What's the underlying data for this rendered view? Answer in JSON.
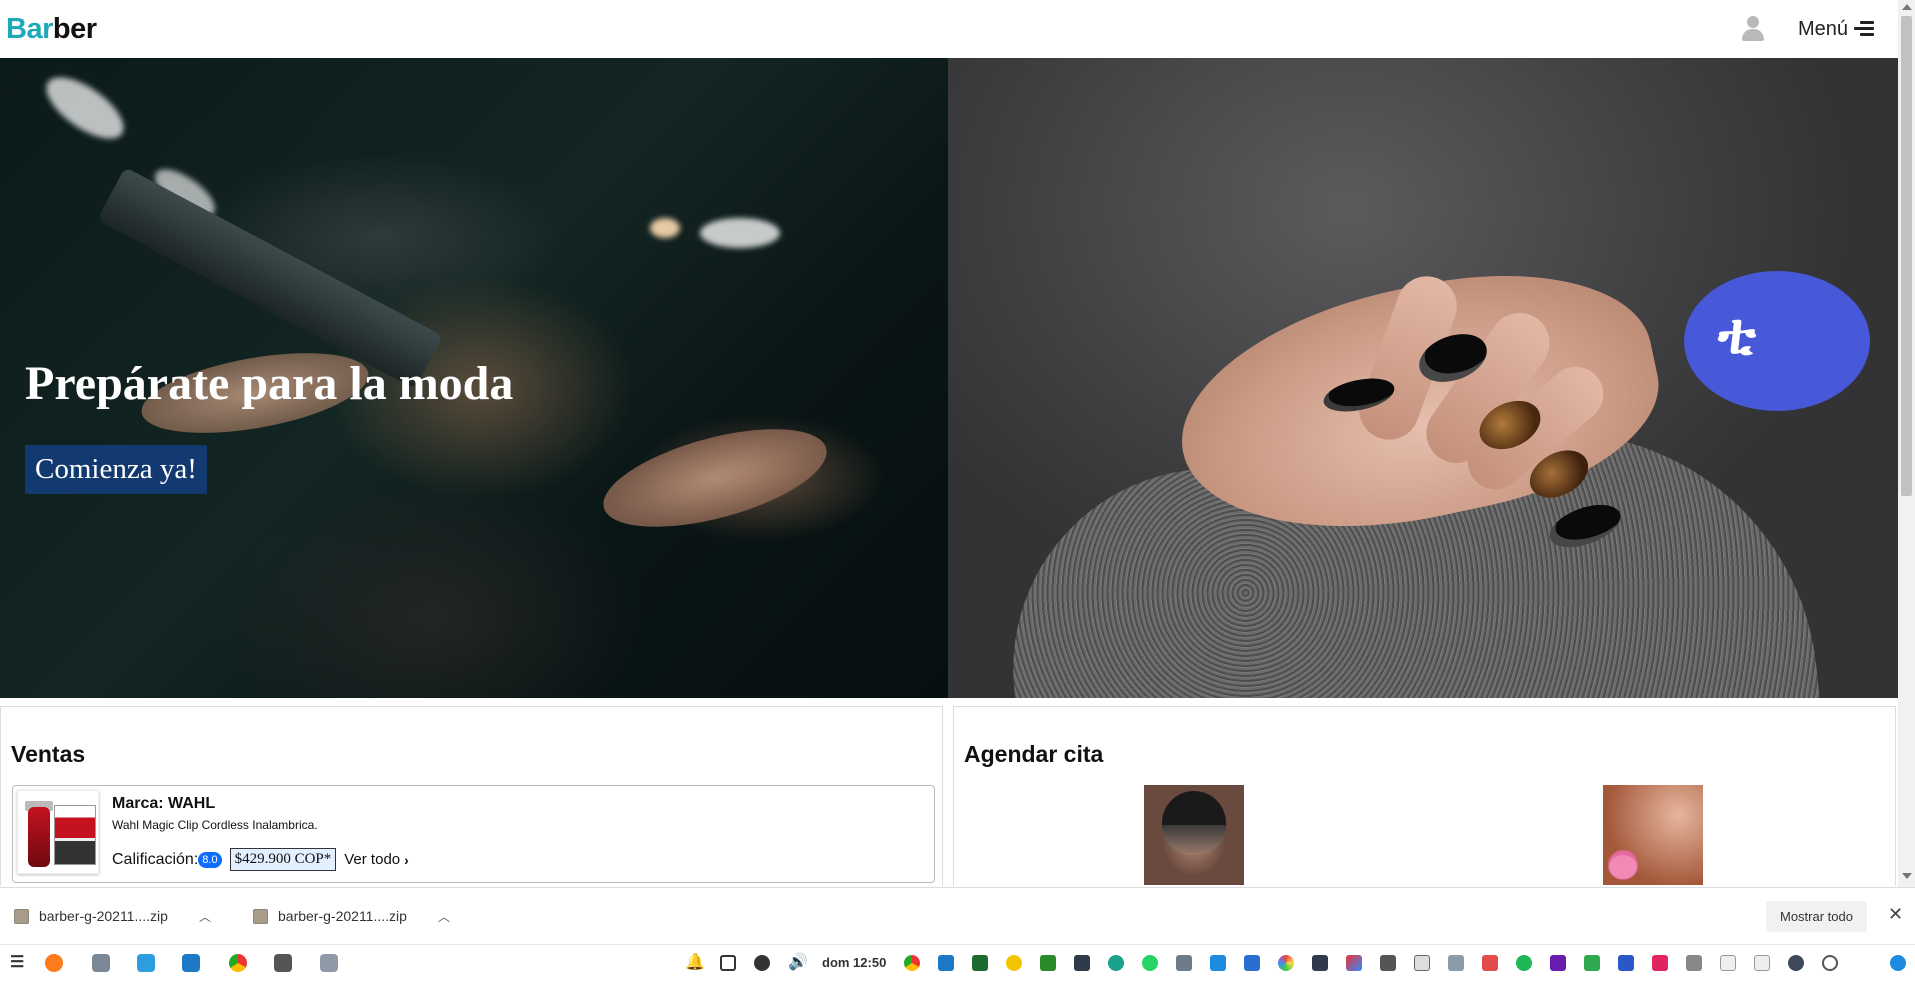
{
  "navbar": {
    "brand_part1": "Bar",
    "brand_part2": "ber",
    "menu_label": "Menú",
    "user_icon": "user-icon",
    "menu_icon": "hamburger-icon"
  },
  "hero": {
    "title": "Prepárate para la moda",
    "cta_label": "Comienza ya!",
    "chat_badge_glyph": "ቲ"
  },
  "ventas": {
    "heading": "Ventas",
    "product": {
      "brand": "Marca: WAHL",
      "description": "Wahl Magic Clip Cordless Inalambrica.",
      "rating_label": "Calificación:",
      "rating": "8.0",
      "price": "$429.900 COP*",
      "see_all": "Ver todo",
      "see_all_icon": "chevron-right-icon"
    }
  },
  "cita": {
    "heading": "Agendar cita"
  },
  "downloads": {
    "items": [
      {
        "name": "barber-g-20211....zip"
      },
      {
        "name": "barber-g-20211....zip"
      }
    ],
    "show_all_label": "Mostrar todo"
  },
  "taskbar": {
    "clock": "dom 12:50"
  },
  "colors": {
    "brand_accent": "#1fa8b8",
    "cta_bg": "#123a70",
    "chat_badge": "#4759d8",
    "rating_badge": "#0d6efd"
  }
}
